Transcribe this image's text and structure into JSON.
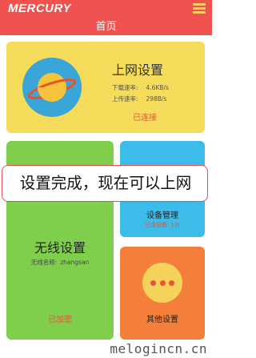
{
  "header": {
    "logo": "MERCURY",
    "title": "首页",
    "menu_icon": "hamburger-icon"
  },
  "internet": {
    "title": "上网设置",
    "download_label": "下载速率:",
    "download_value": "4.6KB/s",
    "upload_label": "上传速率:",
    "upload_value": "298B/s",
    "status": "已连接",
    "icon": "planet-icon"
  },
  "wireless": {
    "title": "无线设置",
    "ssid_label": "无线名称:",
    "ssid_value": "zhangsan",
    "status": "已加密",
    "icon": "wifi-icon"
  },
  "devices": {
    "title": "设备管理",
    "count": "已连设备: 1台",
    "icon": "devices-icon"
  },
  "other": {
    "title": "其他设置",
    "icon": "more-icon"
  },
  "banner": {
    "text": "设置完成，现在可以上网"
  },
  "watermark": "melogincn.cn",
  "colors": {
    "header": "#f0524f",
    "internet_card": "#f5dc5b",
    "wireless_card": "#7fcf4d",
    "devices_card": "#3cbce8",
    "other_card": "#f37f3b",
    "status": "#e5533d"
  }
}
